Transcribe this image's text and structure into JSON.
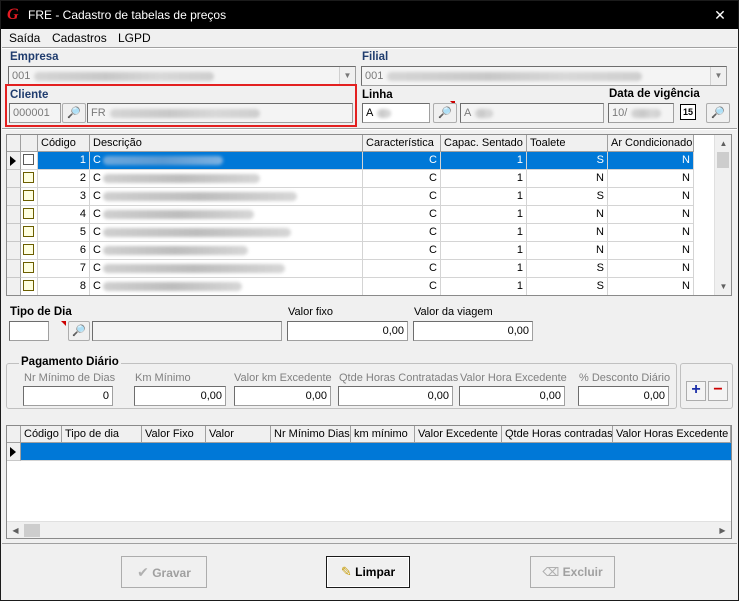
{
  "window": {
    "title": "FRE - Cadastro de tabelas de preços",
    "close_label": "✕"
  },
  "menu": {
    "items": [
      "Saída",
      "Cadastros",
      "LGPD"
    ]
  },
  "empresa": {
    "label": "Empresa",
    "value": "001"
  },
  "filial": {
    "label": "Filial",
    "value": "001"
  },
  "cliente": {
    "label": "Cliente",
    "code": "000001",
    "name": "FR"
  },
  "linha": {
    "label": "Linha",
    "code": "A",
    "name": "A"
  },
  "vigencia": {
    "label": "Data de vigência",
    "value": "10/",
    "calendar_label": "15"
  },
  "main_grid": {
    "columns": [
      "Código",
      "Descrição",
      "Característica",
      "Capac. Sentado",
      "Toalete",
      "Ar Condicionado"
    ],
    "rows": [
      {
        "codigo": "1",
        "descricao": "C",
        "caracteristica": "C",
        "capac": "1",
        "toalete": "S",
        "ar": "N"
      },
      {
        "codigo": "2",
        "descricao": "C",
        "caracteristica": "C",
        "capac": "1",
        "toalete": "N",
        "ar": "N"
      },
      {
        "codigo": "3",
        "descricao": "C",
        "caracteristica": "C",
        "capac": "1",
        "toalete": "S",
        "ar": "N"
      },
      {
        "codigo": "4",
        "descricao": "C",
        "caracteristica": "C",
        "capac": "1",
        "toalete": "N",
        "ar": "N"
      },
      {
        "codigo": "5",
        "descricao": "C",
        "caracteristica": "C",
        "capac": "1",
        "toalete": "N",
        "ar": "N"
      },
      {
        "codigo": "6",
        "descricao": "C",
        "caracteristica": "C",
        "capac": "1",
        "toalete": "N",
        "ar": "N"
      },
      {
        "codigo": "7",
        "descricao": "C",
        "caracteristica": "C",
        "capac": "1",
        "toalete": "S",
        "ar": "N"
      },
      {
        "codigo": "8",
        "descricao": "C",
        "caracteristica": "C",
        "capac": "1",
        "toalete": "S",
        "ar": "N"
      }
    ]
  },
  "tipo_dia": {
    "label": "Tipo de Dia",
    "code": "",
    "name": ""
  },
  "valor_fixo": {
    "label": "Valor fixo",
    "value": "0,00"
  },
  "valor_viagem": {
    "label": "Valor da viagem",
    "value": "0,00"
  },
  "pagamento": {
    "title": "Pagamento Diário",
    "fields": [
      {
        "label": "Nr Mínimo de Dias",
        "value": "0"
      },
      {
        "label": "Km Mínimo",
        "value": "0,00"
      },
      {
        "label": "Valor km Excedente",
        "value": "0,00"
      },
      {
        "label": "Qtde Horas Contratadas",
        "value": "0,00"
      },
      {
        "label": "Valor Hora Excedente",
        "value": "0,00"
      },
      {
        "label": "% Desconto Diário",
        "value": "0,00"
      }
    ],
    "add_label": "+",
    "remove_label": "−"
  },
  "detail_grid": {
    "columns": [
      "Código",
      "Tipo de dia",
      "Valor Fixo",
      "Valor",
      "Nr Mínimo Dias",
      "km mínimo",
      "Valor Excedente",
      "Qtde Horas contradas",
      "Valor Horas Excedente"
    ]
  },
  "buttons": {
    "gravar": "Gravar",
    "limpar": "Limpar",
    "excluir": "Excluir"
  },
  "colors": {
    "selection": "#0078d7",
    "highlight": "#e32020",
    "label": "#1f3c6e"
  }
}
